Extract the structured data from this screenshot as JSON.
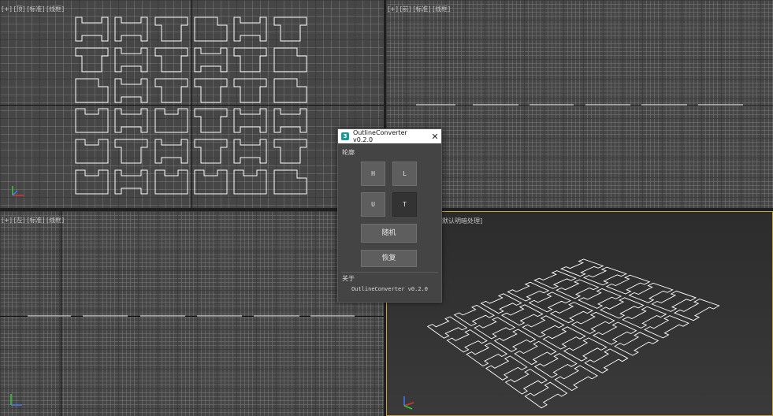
{
  "viewports": {
    "top": {
      "label": "[+] [顶] [标准] [线框]"
    },
    "front": {
      "label": "[+] [前] [标准] [线框]"
    },
    "left": {
      "label": "[+] [左] [标准] [线框]"
    },
    "perspective": {
      "label": "默认明暗处理]"
    }
  },
  "dialog": {
    "title": "OutlineConverter v0.2.0",
    "icon": "3",
    "close": "✕",
    "group_label": "轮廓",
    "buttons": {
      "h": "H",
      "l": "L",
      "u": "U",
      "t": "T",
      "random": "随机",
      "restore": "恢复"
    },
    "about_label": "关于",
    "version_text": "OutlineConverter v0.2.0"
  },
  "colors": {
    "viewport_bg": "#464646",
    "active_border": "#c9a54a",
    "outline": "#ffffff"
  }
}
